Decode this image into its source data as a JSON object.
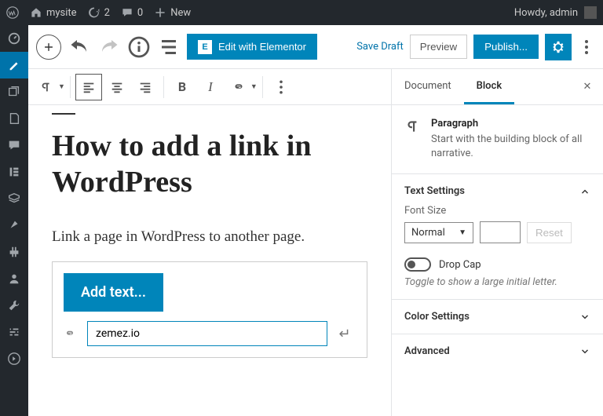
{
  "adminbar": {
    "site": "mysite",
    "updates": "2",
    "comments": "0",
    "new": "New",
    "howdy": "Howdy, admin"
  },
  "toolbar": {
    "elementor": "Edit with Elementor",
    "save_draft": "Save Draft",
    "preview": "Preview",
    "publish": "Publish..."
  },
  "content": {
    "title": "How to add a link in WordPress",
    "paragraph": "Link a page in WordPress to another page.",
    "add_text": "Add text...",
    "link_value": "zemez.io"
  },
  "panel": {
    "tab_document": "Document",
    "tab_block": "Block",
    "block_title": "Paragraph",
    "block_desc": "Start with the building block of all narrative.",
    "section_text": "Text Settings",
    "font_size_label": "Font Size",
    "font_size_value": "Normal",
    "reset": "Reset",
    "drop_cap": "Drop Cap",
    "drop_cap_hint": "Toggle to show a large initial letter.",
    "section_color": "Color Settings",
    "section_adv": "Advanced"
  }
}
